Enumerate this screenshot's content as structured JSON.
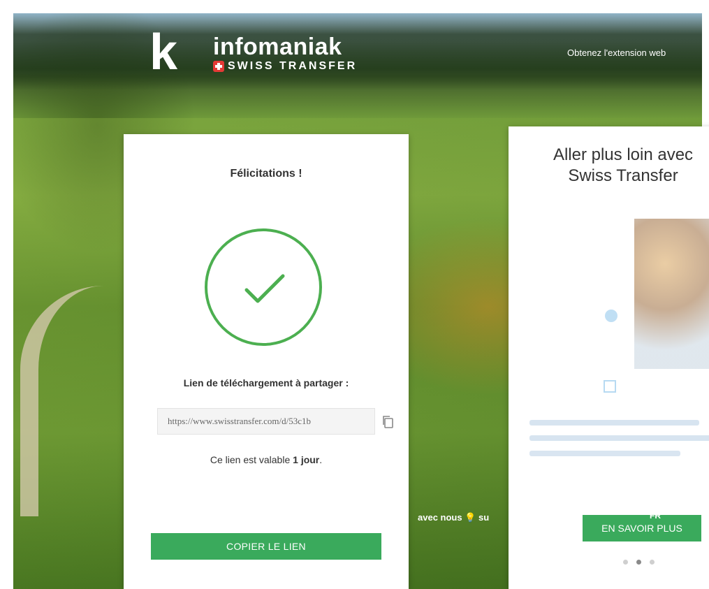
{
  "logo": {
    "letter": "k",
    "brand": "infomaniak",
    "product": "SWISS TRANSFER"
  },
  "header": {
    "extension_link": "Obtenez l'extension web"
  },
  "success_card": {
    "title": "Félicitations !",
    "link_label": "Lien de téléchargement à partager :",
    "url_value": "https://www.swisstransfer.com/d/53c1b",
    "validity_prefix": "Ce lien est valable ",
    "validity_value": "1 jour",
    "validity_suffix": ".",
    "copy_button": "COPIER LE LIEN",
    "accent_color": "#3aaa5c",
    "check_color": "#4caf50"
  },
  "background_text": "avec nous 💡 su",
  "promo_card": {
    "title": "Aller plus loin avec Swiss Transfer",
    "cta_button": "EN SAVOIR PLUS",
    "lang": "FR",
    "slides": 3,
    "active_slide": 2
  },
  "icons": {
    "copy": "copy-icon",
    "check": "checkmark-icon",
    "flag": "swiss-flag-icon"
  }
}
